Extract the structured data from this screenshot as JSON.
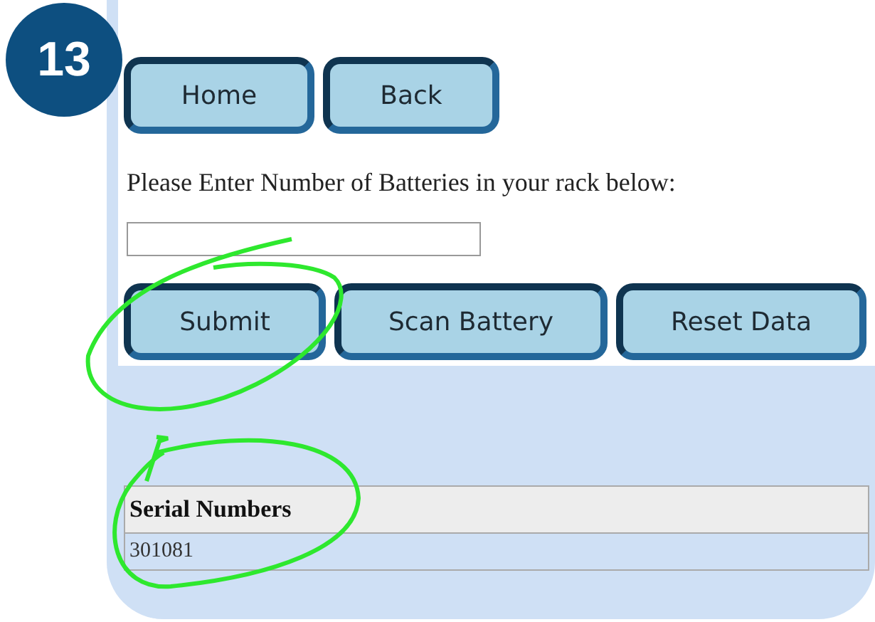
{
  "step_badge": "13",
  "nav_buttons": [
    {
      "label": "Home"
    },
    {
      "label": "Back"
    }
  ],
  "prompt": "Please Enter Number of Batteries in your rack below:",
  "action_buttons": [
    {
      "label": "Submit"
    },
    {
      "label": "Scan Battery"
    },
    {
      "label": "Reset Data"
    }
  ],
  "table": {
    "columns": [
      "Serial Numbers"
    ],
    "rows": [
      [
        "301081"
      ]
    ]
  }
}
